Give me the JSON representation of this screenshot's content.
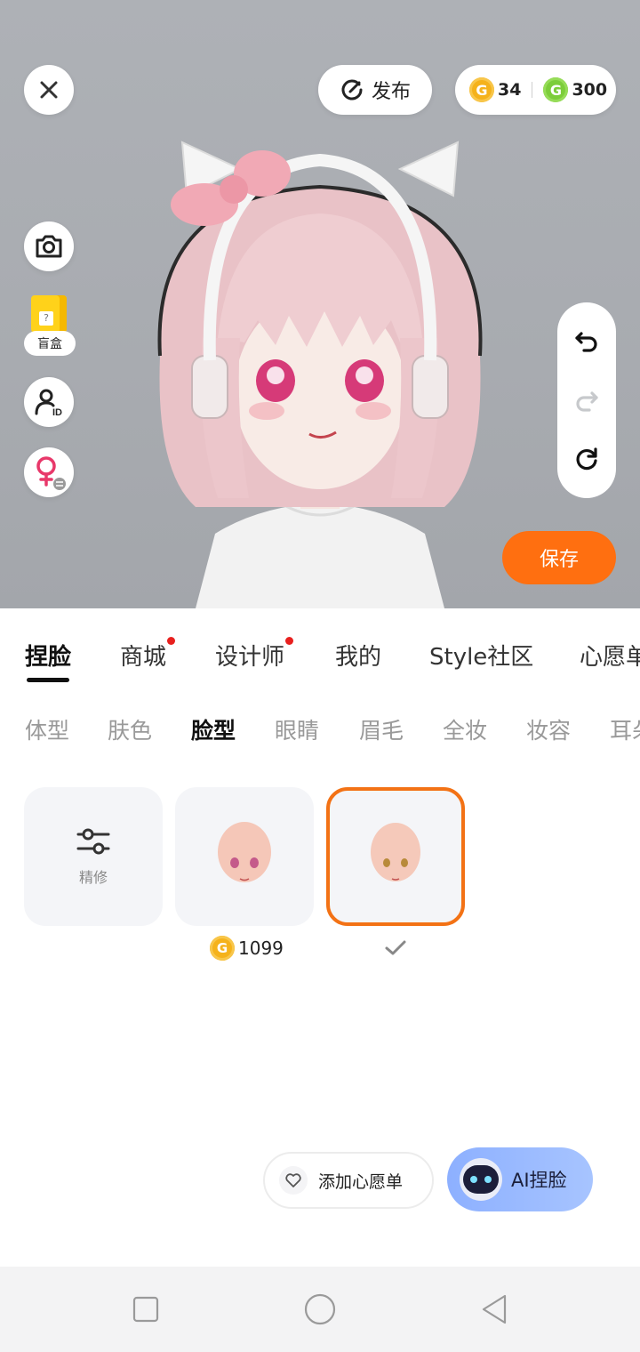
{
  "header": {
    "publish_label": "发布",
    "coins_gold": "34",
    "coins_green": "300"
  },
  "side_tools": {
    "blind_box_label": "盲盒"
  },
  "save_label": "保存",
  "tabs": [
    {
      "label": "捏脸",
      "active": true,
      "badge": false
    },
    {
      "label": "商城",
      "active": false,
      "badge": true
    },
    {
      "label": "设计师",
      "active": false,
      "badge": true
    },
    {
      "label": "我的",
      "active": false,
      "badge": false
    },
    {
      "label": "Style社区",
      "active": false,
      "badge": false
    },
    {
      "label": "心愿单",
      "active": false,
      "badge": false
    }
  ],
  "subtabs": [
    {
      "label": "体型",
      "active": false
    },
    {
      "label": "肤色",
      "active": false
    },
    {
      "label": "脸型",
      "active": true
    },
    {
      "label": "眼睛",
      "active": false
    },
    {
      "label": "眉毛",
      "active": false
    },
    {
      "label": "全妆",
      "active": false
    },
    {
      "label": "妆容",
      "active": false
    },
    {
      "label": "耳朵",
      "active": false
    }
  ],
  "items": {
    "refine_label": "精修",
    "face1_price": "1099"
  },
  "actions": {
    "wishlist_label": "添加心愿单",
    "ai_label": "AI捏脸"
  },
  "colors": {
    "accent": "#ff6f10",
    "selected_border": "#f37215",
    "badge_red": "#e8201e"
  }
}
